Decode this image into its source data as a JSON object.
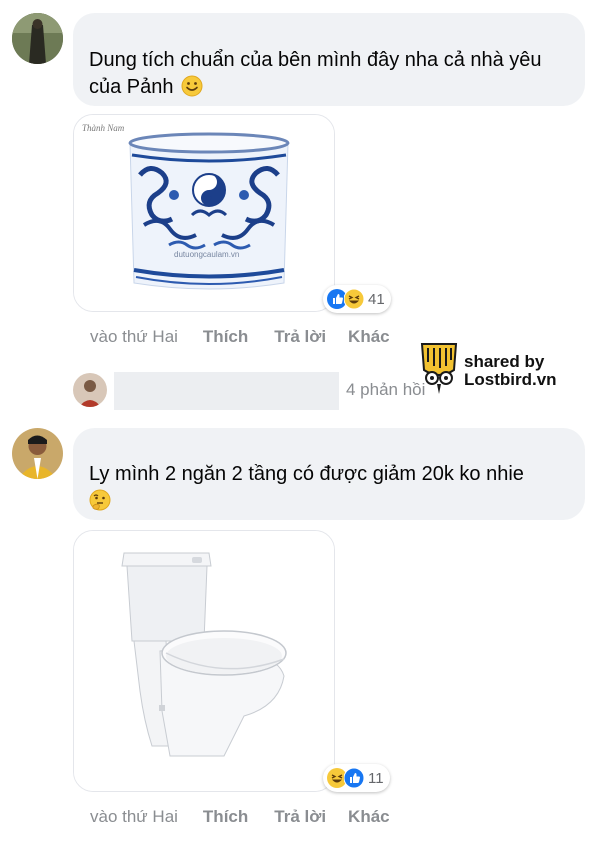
{
  "comments": [
    {
      "text_line1": "Dung tích chuẩn của bên mình đây nha cả nhà yêu",
      "text_line2": "của Pảnh",
      "image_caption_left": "Thành Nam",
      "image_caption_mid": "dutuongcaulam.vn",
      "reaction_count": "41",
      "time": "vào thứ Hai",
      "like": "Thích",
      "reply": "Trả lời",
      "more": "Khác"
    },
    {
      "text_line1": "Ly mình 2 ngăn 2 tầng có được giảm 20k ko nhie",
      "reaction_count": "11",
      "time": "vào thứ Hai",
      "like": "Thích",
      "reply": "Trả lời",
      "more": "Khác"
    }
  ],
  "replies_link": "4 phản hồi",
  "watermark": {
    "line1": "shared by",
    "line2": "Lostbird.vn"
  }
}
